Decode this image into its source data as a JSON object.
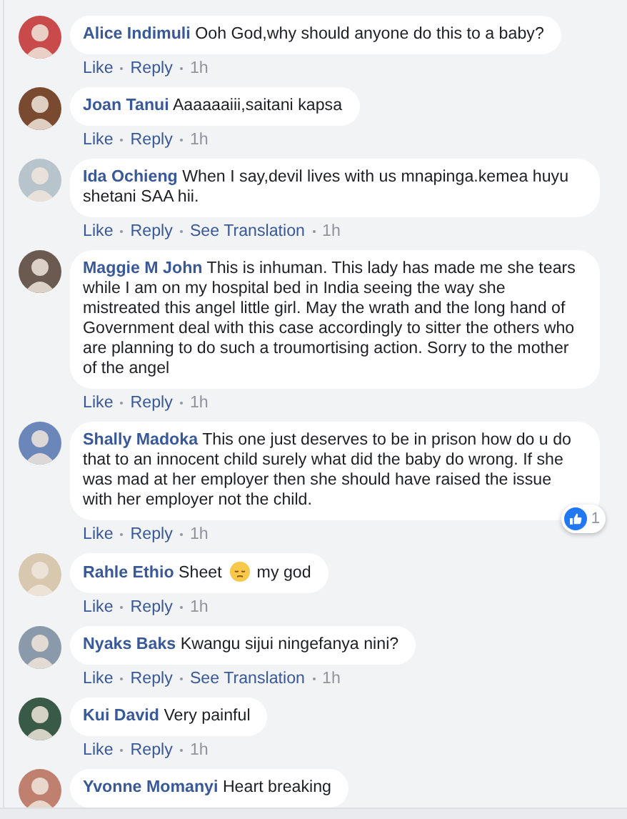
{
  "comments": [
    {
      "author": "Alice Indimuli",
      "segments": [
        {
          "kind": "text",
          "text": "Ooh God,why should anyone do this to a baby?"
        }
      ],
      "actions": [
        "Like",
        "Reply"
      ],
      "time": "1h"
    },
    {
      "author": "Joan Tanui",
      "segments": [
        {
          "kind": "text",
          "text": "Aaaaaaiii,saitani kapsa"
        }
      ],
      "actions": [
        "Like",
        "Reply"
      ],
      "time": "1h"
    },
    {
      "author": "Ida Ochieng",
      "segments": [
        {
          "kind": "text",
          "text": "When I say,devil lives with us mnapinga.kemea huyu shetani SAA hii."
        }
      ],
      "actions": [
        "Like",
        "Reply",
        "See Translation"
      ],
      "time": "1h"
    },
    {
      "author": "Maggie M John",
      "segments": [
        {
          "kind": "text",
          "text": "This is inhuman. This lady has made me she tears while I am on my hospital bed in India seeing the way she mistreated this angel little girl. May the wrath and the long hand of Government deal with this case accordingly to sitter the others who are planning to do such a troumortising action. Sorry to the mother of the angel"
        }
      ],
      "actions": [
        "Like",
        "Reply"
      ],
      "time": "1h"
    },
    {
      "author": "Shally Madoka",
      "segments": [
        {
          "kind": "text",
          "text": "This one just deserves to be in prison how do u do that to an innocent child surely what did the baby do wrong. If she was mad at her employer then she should have raised the issue with her employer not the child."
        }
      ],
      "actions": [
        "Like",
        "Reply"
      ],
      "time": "1h",
      "reactions": "1"
    },
    {
      "author": "Rahle Ethio",
      "segments": [
        {
          "kind": "text",
          "text": "Sheet"
        },
        {
          "kind": "emoji"
        },
        {
          "kind": "text",
          "text": "my god"
        }
      ],
      "actions": [
        "Like",
        "Reply"
      ],
      "time": "1h"
    },
    {
      "author": "Nyaks Baks",
      "segments": [
        {
          "kind": "text",
          "text": "Kwangu sijui ningefanya nini?"
        }
      ],
      "actions": [
        "Like",
        "Reply",
        "See Translation"
      ],
      "time": "1h"
    },
    {
      "author": "Kui David",
      "segments": [
        {
          "kind": "text",
          "text": "Very painful"
        }
      ],
      "actions": [
        "Like",
        "Reply"
      ],
      "time": "1h"
    },
    {
      "author": "Yvonne Momanyi",
      "segments": [
        {
          "kind": "text",
          "text": "Heart breaking"
        }
      ]
    }
  ]
}
